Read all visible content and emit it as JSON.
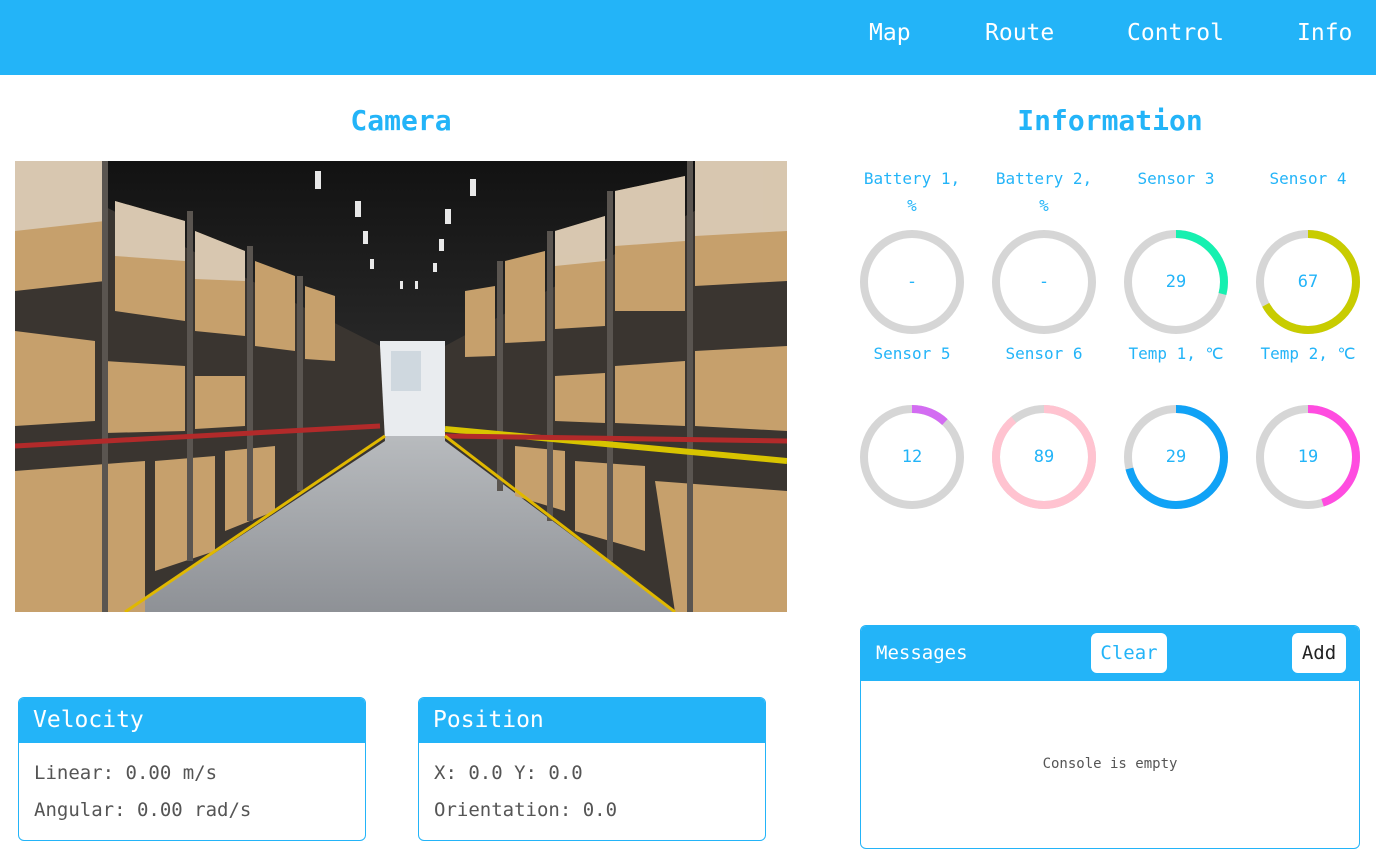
{
  "nav": {
    "items": [
      "Map",
      "Route",
      "Control",
      "Info"
    ]
  },
  "camera": {
    "title": "Camera"
  },
  "information": {
    "title": "Information",
    "gauges": [
      {
        "label_line1": "Battery 1,",
        "label_line2": "%",
        "value": "-",
        "percent": 0,
        "color": "#23b4f8"
      },
      {
        "label_line1": "Battery 2,",
        "label_line2": "%",
        "value": "-",
        "percent": 0,
        "color": "#23b4f8"
      },
      {
        "label_line1": "Sensor 3",
        "label_line2": "",
        "value": "29",
        "percent": 29,
        "color": "#16f0b0"
      },
      {
        "label_line1": "Sensor 4",
        "label_line2": "",
        "value": "67",
        "percent": 67,
        "color": "#c8cc00"
      },
      {
        "label_line1": "Sensor 5",
        "label_line2": "",
        "value": "12",
        "percent": 12,
        "color": "#d36cf2"
      },
      {
        "label_line1": "Sensor 6",
        "label_line2": "",
        "value": "89",
        "percent": 89,
        "color": "#ffc3d0"
      },
      {
        "label_line1": "Temp 1, ℃",
        "label_line2": "",
        "value": "29",
        "percent": 71,
        "color": "#10a2f6"
      },
      {
        "label_line1": "Temp 2, ℃",
        "label_line2": "",
        "value": "19",
        "percent": 45,
        "color": "#ff4ce0"
      }
    ],
    "track_color": "#d6d6d6"
  },
  "velocity": {
    "title": "Velocity",
    "linear": "Linear: 0.00 m/s",
    "angular": "Angular: 0.00 rad/s"
  },
  "position": {
    "title": "Position",
    "xy": "X: 0.0 Y: 0.0",
    "orientation": "Orientation: 0.0"
  },
  "messages": {
    "title": "Messages",
    "clear_label": "Clear",
    "add_label": "Add",
    "empty_text": "Console is empty"
  },
  "colors": {
    "accent": "#23b4f8"
  }
}
